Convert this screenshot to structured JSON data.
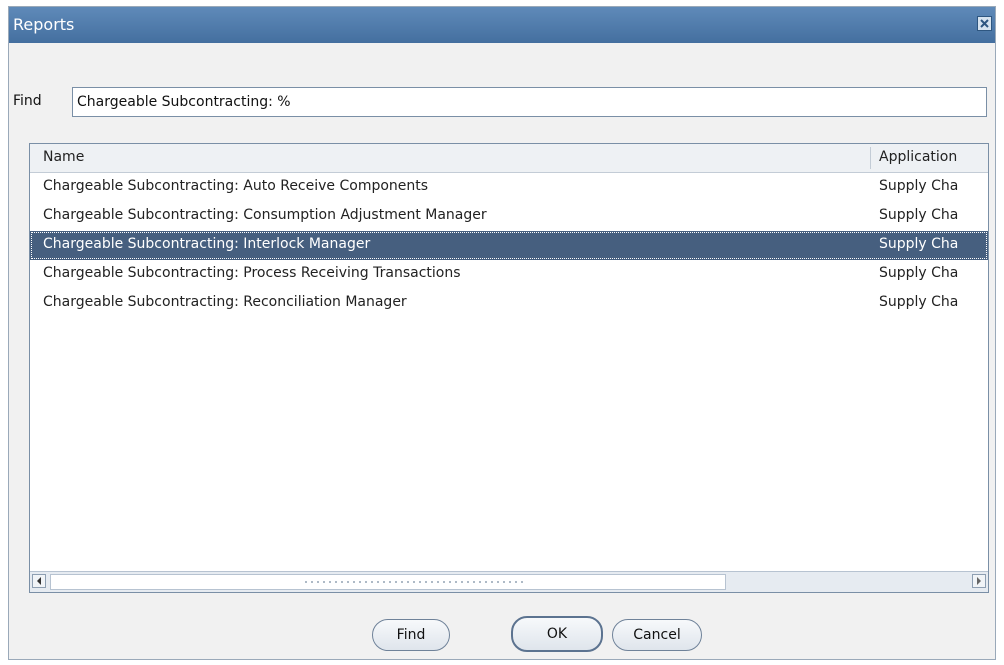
{
  "window": {
    "title": "Reports",
    "close_icon": "close-icon"
  },
  "find": {
    "label": "Find",
    "value": "Chargeable Subcontracting: %"
  },
  "list": {
    "columns": [
      "Name",
      "Application"
    ],
    "rows": [
      {
        "name": "Chargeable Subcontracting: Auto Receive Components",
        "app": "Supply Cha"
      },
      {
        "name": "Chargeable Subcontracting: Consumption Adjustment Manager",
        "app": "Supply Cha"
      },
      {
        "name": "Chargeable Subcontracting: Interlock Manager",
        "app": "Supply Cha"
      },
      {
        "name": "Chargeable Subcontracting: Process Receiving Transactions",
        "app": "Supply Cha"
      },
      {
        "name": "Chargeable Subcontracting: Reconciliation Manager",
        "app": "Supply Cha"
      }
    ],
    "selected_row": "Chargeable Subcontracting: Interlock Manager"
  },
  "buttons": {
    "find": "Find",
    "ok": "OK",
    "cancel": "Cancel"
  },
  "colors": {
    "titlebar": "#4f7bab",
    "selection": "#465f7f"
  }
}
